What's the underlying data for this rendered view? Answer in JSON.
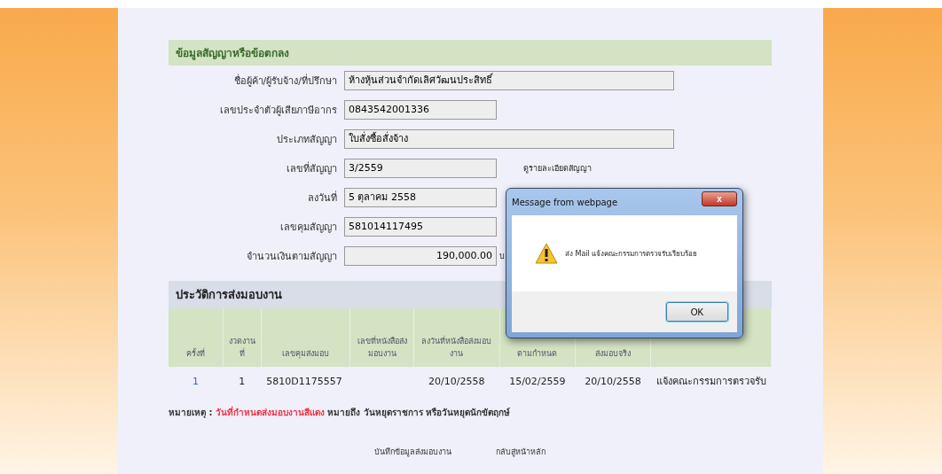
{
  "contract": {
    "title": "ข้อมูลสัญญาหรือข้อตกลง",
    "fields": [
      {
        "label": "ชื่อผู้ค้า/ผู้รับจ้าง/ที่ปรึกษา",
        "value": "ห้างหุ้นส่วนจำกัดเลิศวัฒนประสิทธิ์",
        "kind": "wide"
      },
      {
        "label": "เลขประจำตัวผู้เสียภาษีอากร",
        "value": "0843542001336",
        "kind": "short"
      },
      {
        "label": "ประเภทสัญญา",
        "value": "ใบสั่งซื้อสั่งจ้าง",
        "kind": "wide"
      },
      {
        "label": "เลขที่สัญญา",
        "value": "3/2559",
        "kind": "short",
        "link": "ดูรายละเอียดสัญญา"
      },
      {
        "label": "ลงวันที่",
        "value": "5 ตุลาคม 2558",
        "kind": "short"
      },
      {
        "label": "เลขคุมสัญญา",
        "value": "581014117495",
        "kind": "short"
      },
      {
        "label": "จำนวนเงินตามสัญญา",
        "value": "190,000.00",
        "kind": "amount",
        "unit": "บ"
      }
    ]
  },
  "history": {
    "title": "ประวัติการส่งมอบงาน",
    "columns": [
      "ครั้งที่",
      "งวดงานที่",
      "เลขคุมส่งมอบ",
      "เลขที่หนังสือส่งมอบงาน",
      "ลงวันที่หนังสือส่งมอบงาน",
      "ตามกำหนด",
      "ส่งมอบจริง"
    ],
    "rows": [
      {
        "cells": [
          "1",
          "1",
          "5810D1175557",
          "",
          "20/10/2558",
          "15/02/2559",
          "20/10/2558",
          "แจ้งคณะกรรมการตรวจรับ"
        ]
      }
    ]
  },
  "note": {
    "prefix": "หมายเหตุ : ",
    "highlight": "วันที่กำหนดส่งมอบงานสีแดง",
    "suffix": " หมายถึง วันหยุดราชการ หรือวันหยุดนักขัตฤกษ์"
  },
  "links": [
    "บันทึกข้อมูลส่งมอบงาน",
    "กลับสู่หน้าหลัก"
  ],
  "dialog": {
    "title": "Message from webpage",
    "close": "x",
    "message": "ส่ง Mail แจ้งคณะกรรมการตรวจรับเรียบร้อย",
    "button": "OK"
  }
}
